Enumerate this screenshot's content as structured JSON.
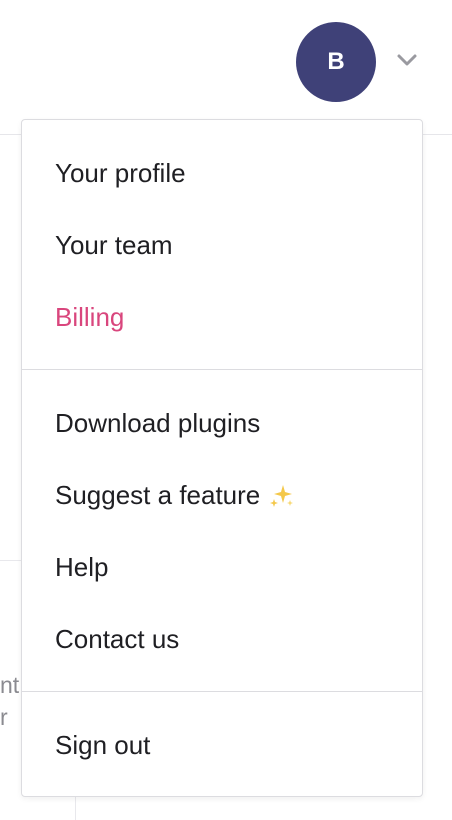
{
  "header": {
    "avatar_initial": "B",
    "colors": {
      "avatar_bg": "#3f4178",
      "chevron": "#9a9aa0"
    }
  },
  "background": {
    "partial_text_1": "nt",
    "partial_text_2": "r"
  },
  "menu": {
    "group1": [
      {
        "label": "Your profile"
      },
      {
        "label": "Your team"
      },
      {
        "label": "Billing"
      }
    ],
    "group2": [
      {
        "label": "Download plugins"
      },
      {
        "label": "Suggest a feature",
        "icon": "sparkles-icon"
      },
      {
        "label": "Help"
      },
      {
        "label": "Contact us"
      }
    ],
    "group3": [
      {
        "label": "Sign out"
      }
    ],
    "colors": {
      "accent": "#d9467d",
      "text": "#1f1f23",
      "divider": "#dcdce0"
    }
  }
}
